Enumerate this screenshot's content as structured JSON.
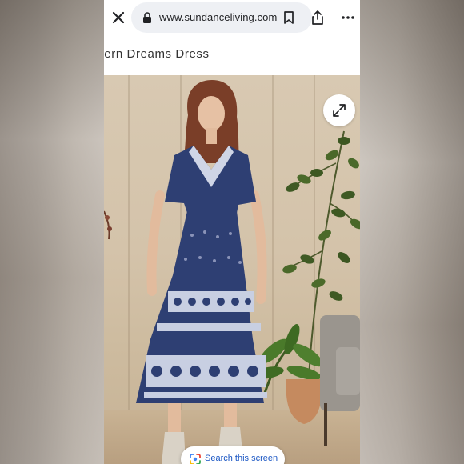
{
  "browser": {
    "url": "www.sundanceliving.com",
    "close_icon": "close-icon",
    "lock_icon": "lock-icon",
    "bookmark_icon": "bookmark-icon",
    "share_icon": "share-icon",
    "more_icon": "more-vertical-icon"
  },
  "product": {
    "title": "Western Dreams Dress",
    "expand_icon": "expand-icon"
  },
  "lens": {
    "label": "Search this screen",
    "icon": "lens-icon"
  },
  "colors": {
    "dress_navy": "#2e3f73",
    "link_blue": "#1a56c4"
  }
}
